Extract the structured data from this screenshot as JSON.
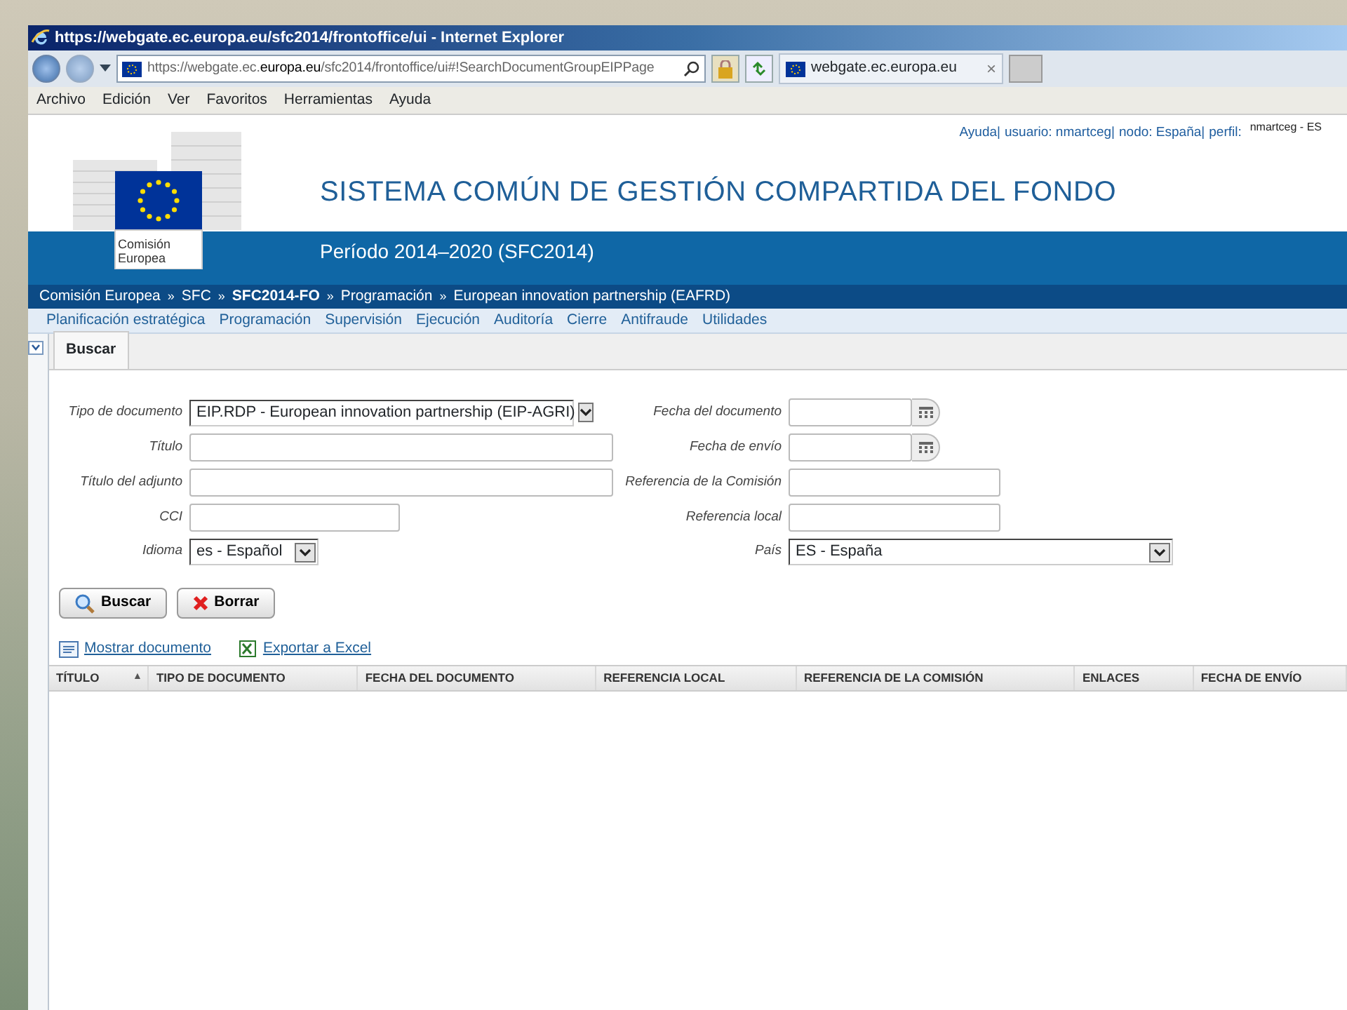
{
  "window": {
    "title": "https://webgate.ec.europa.eu/sfc2014/frontoffice/ui - Internet Explorer"
  },
  "address_bar": {
    "url_prefix": "https://webgate.ec.",
    "url_domain": "europa.eu",
    "url_path": "/sfc2014/frontoffice/ui#!SearchDocumentGroupEIPPage"
  },
  "browser_tab": {
    "title": "webgate.ec.europa.eu",
    "close": "×"
  },
  "menu_bar": [
    "Archivo",
    "Edición",
    "Ver",
    "Favoritos",
    "Herramientas",
    "Ayuda"
  ],
  "header": {
    "links": [
      "Ayuda|",
      "usuario: nmartceg|",
      "nodo: España|",
      "perfil:"
    ],
    "profile": "nmartceg - ES",
    "logo_lines": [
      "Comisión",
      "Europea"
    ],
    "title": "SISTEMA COMÚN DE GESTIÓN COMPARTIDA DEL FONDO",
    "subtitle": "Período 2014–2020 (SFC2014)"
  },
  "breadcrumb": {
    "separator": "»",
    "items": [
      {
        "label": "Comisión Europea",
        "bold": false
      },
      {
        "label": "SFC",
        "bold": false
      },
      {
        "label": "SFC2014-FO",
        "bold": true
      },
      {
        "label": "Programación",
        "bold": false
      },
      {
        "label": "European innovation partnership (EAFRD)",
        "bold": false
      }
    ]
  },
  "nav_menu": [
    "Planificación estratégica",
    "Programación",
    "Supervisión",
    "Ejecución",
    "Auditoría",
    "Cierre",
    "Antifraude",
    "Utilidades"
  ],
  "page_tabs": [
    {
      "label": "Buscar",
      "selected": true
    }
  ],
  "form": {
    "fields": [
      {
        "label": "Tipo de documento",
        "kind": "select",
        "value": "EIP.RDP - European innovation partnership (EIP-AGRI)"
      },
      {
        "label": "Fecha del documento",
        "kind": "date"
      },
      {
        "label": "Título",
        "kind": "text"
      },
      {
        "label": "Fecha de envío",
        "kind": "date"
      },
      {
        "label": "Título del adjunto",
        "kind": "text"
      },
      {
        "label": "Referencia de la Comisión",
        "kind": "text"
      },
      {
        "label": "CCI",
        "kind": "text"
      },
      {
        "label": "Referencia local",
        "kind": "text"
      },
      {
        "label": "Idioma",
        "kind": "select",
        "value": "es - Español"
      },
      {
        "label": "País",
        "kind": "select",
        "value": "ES - España"
      }
    ],
    "buttons": [
      {
        "label": "Buscar",
        "kind": "search"
      },
      {
        "label": "Borrar",
        "kind": "clear"
      }
    ]
  },
  "links": [
    {
      "label": "Mostrar documento",
      "kind": "document"
    },
    {
      "label": "Exportar a Excel",
      "kind": "excel"
    }
  ],
  "table": {
    "columns": [
      {
        "label": "TÍTULO",
        "sort_mark": "▲"
      },
      {
        "label": "TIPO DE DOCUMENTO"
      },
      {
        "label": "FECHA DEL DOCUMENTO"
      },
      {
        "label": "REFERENCIA LOCAL"
      },
      {
        "label": "REFERENCIA DE LA COMISIÓN"
      },
      {
        "label": "ENLACES"
      },
      {
        "label": "FECHA DE ENVÍO"
      }
    ]
  }
}
